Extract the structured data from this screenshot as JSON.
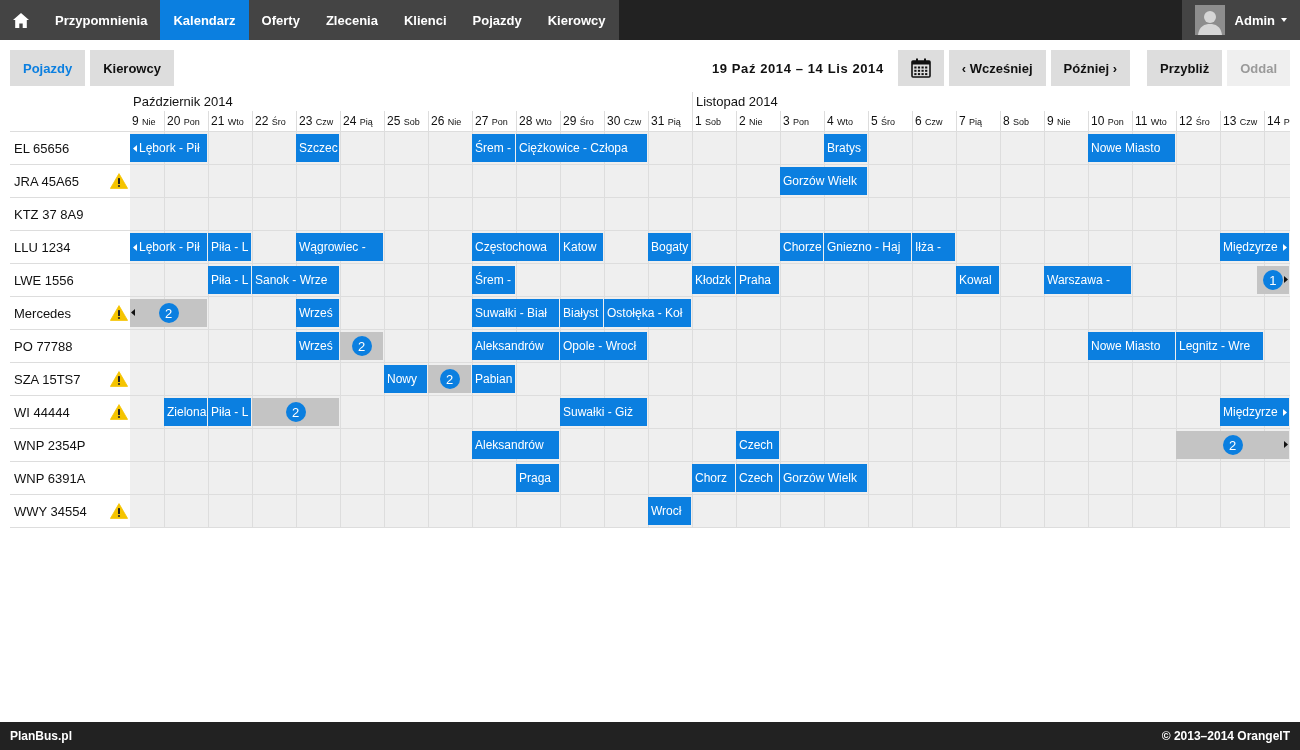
{
  "nav": {
    "items": [
      {
        "label": "Przypomnienia",
        "selected": false
      },
      {
        "label": "Kalendarz",
        "selected": true
      },
      {
        "label": "Oferty",
        "selected": false
      },
      {
        "label": "Zlecenia",
        "selected": false
      },
      {
        "label": "Klienci",
        "selected": false
      },
      {
        "label": "Pojazdy",
        "selected": false
      },
      {
        "label": "Kierowcy",
        "selected": false
      }
    ],
    "user": {
      "name": "Admin"
    }
  },
  "toolbar": {
    "views": [
      {
        "label": "Pojazdy",
        "selected": true
      },
      {
        "label": "Kierowcy",
        "selected": false
      }
    ],
    "range": "19 Paź 2014 – 14 Lis 2014",
    "navigation": [
      {
        "label": "‹ Wcześniej",
        "disabled": false
      },
      {
        "label": "Później ›",
        "disabled": false
      }
    ],
    "zoom": [
      {
        "label": "Przybliż",
        "disabled": false
      },
      {
        "label": "Oddal",
        "disabled": true
      }
    ]
  },
  "timeline": {
    "months": [
      {
        "label": "Październik 2014",
        "days": [
          {
            "day": "9",
            "weekday": "Nie"
          },
          {
            "day": "20",
            "weekday": "Pon"
          },
          {
            "day": "21",
            "weekday": "Wto"
          },
          {
            "day": "22",
            "weekday": "Śro"
          },
          {
            "day": "23",
            "weekday": "Czw"
          },
          {
            "day": "24",
            "weekday": "Pią"
          },
          {
            "day": "25",
            "weekday": "Sob"
          },
          {
            "day": "26",
            "weekday": "Nie"
          },
          {
            "day": "27",
            "weekday": "Pon"
          },
          {
            "day": "28",
            "weekday": "Wto"
          },
          {
            "day": "29",
            "weekday": "Śro"
          },
          {
            "day": "30",
            "weekday": "Czw"
          },
          {
            "day": "31",
            "weekday": "Pią"
          }
        ]
      },
      {
        "label": "Listopad 2014",
        "days": [
          {
            "day": "1",
            "weekday": "Sob"
          },
          {
            "day": "2",
            "weekday": "Nie"
          },
          {
            "day": "3",
            "weekday": "Pon"
          },
          {
            "day": "4",
            "weekday": "Wto"
          },
          {
            "day": "5",
            "weekday": "Śro"
          },
          {
            "day": "6",
            "weekday": "Czw"
          },
          {
            "day": "7",
            "weekday": "Pią"
          },
          {
            "day": "8",
            "weekday": "Sob"
          },
          {
            "day": "9",
            "weekday": "Nie"
          },
          {
            "day": "10",
            "weekday": "Pon"
          },
          {
            "day": "11",
            "weekday": "Wto"
          },
          {
            "day": "12",
            "weekday": "Śro"
          },
          {
            "day": "13",
            "weekday": "Czw"
          },
          {
            "day": "14",
            "weekday": "P"
          }
        ]
      }
    ],
    "rows": [
      {
        "name": "EL 65656",
        "warning": false,
        "slots": [
          {
            "kind": "trip",
            "label": "Lębork - Pił",
            "continues_before": true,
            "continues_after": false,
            "late_start": false
          },
          {
            "kind": "continued"
          },
          {
            "kind": "empty"
          },
          {
            "kind": "empty"
          },
          {
            "kind": "trip",
            "label": "Szczec",
            "continues_before": false,
            "continues_after": false,
            "late_start": false
          },
          {
            "kind": "empty"
          },
          {
            "kind": "empty"
          },
          {
            "kind": "empty"
          },
          {
            "kind": "trip",
            "label": "Śrem -",
            "continues_before": false,
            "continues_after": false,
            "late_start": false
          },
          {
            "kind": "trip",
            "label": "Ciężkowice - Człopa",
            "continues_before": false,
            "continues_after": false,
            "late_start": false
          },
          {
            "kind": "continued"
          },
          {
            "kind": "continued"
          },
          {
            "kind": "empty"
          },
          {
            "kind": "empty"
          },
          {
            "kind": "empty"
          },
          {
            "kind": "empty"
          },
          {
            "kind": "trip",
            "label": "Bratys",
            "continues_before": false,
            "continues_after": false,
            "late_start": false
          },
          {
            "kind": "empty"
          },
          {
            "kind": "empty"
          },
          {
            "kind": "empty"
          },
          {
            "kind": "empty"
          },
          {
            "kind": "empty"
          },
          {
            "kind": "trip",
            "label": "Nowe Miasto",
            "continues_before": false,
            "continues_after": false,
            "late_start": false
          },
          {
            "kind": "continued"
          },
          {
            "kind": "empty"
          },
          {
            "kind": "empty"
          },
          {
            "kind": "empty"
          }
        ]
      },
      {
        "name": "JRA 45A65",
        "warning": true,
        "slots": [
          {
            "kind": "empty"
          },
          {
            "kind": "empty"
          },
          {
            "kind": "empty"
          },
          {
            "kind": "empty"
          },
          {
            "kind": "empty"
          },
          {
            "kind": "empty"
          },
          {
            "kind": "empty"
          },
          {
            "kind": "empty"
          },
          {
            "kind": "empty"
          },
          {
            "kind": "empty"
          },
          {
            "kind": "empty"
          },
          {
            "kind": "empty"
          },
          {
            "kind": "empty"
          },
          {
            "kind": "empty"
          },
          {
            "kind": "empty"
          },
          {
            "kind": "trip",
            "label": "Gorzów Wielk",
            "continues_before": false,
            "continues_after": false,
            "late_start": false
          },
          {
            "kind": "continued"
          },
          {
            "kind": "empty"
          },
          {
            "kind": "empty"
          },
          {
            "kind": "empty"
          },
          {
            "kind": "empty"
          },
          {
            "kind": "empty"
          },
          {
            "kind": "empty"
          },
          {
            "kind": "empty"
          },
          {
            "kind": "empty"
          },
          {
            "kind": "empty"
          },
          {
            "kind": "empty"
          }
        ]
      },
      {
        "name": "KTZ 37 8A9",
        "warning": false,
        "slots": [
          {
            "kind": "empty"
          },
          {
            "kind": "empty"
          },
          {
            "kind": "empty"
          },
          {
            "kind": "empty"
          },
          {
            "kind": "empty"
          },
          {
            "kind": "empty"
          },
          {
            "kind": "empty"
          },
          {
            "kind": "empty"
          },
          {
            "kind": "empty"
          },
          {
            "kind": "empty"
          },
          {
            "kind": "empty"
          },
          {
            "kind": "empty"
          },
          {
            "kind": "empty"
          },
          {
            "kind": "empty"
          },
          {
            "kind": "empty"
          },
          {
            "kind": "empty"
          },
          {
            "kind": "empty"
          },
          {
            "kind": "empty"
          },
          {
            "kind": "empty"
          },
          {
            "kind": "empty"
          },
          {
            "kind": "empty"
          },
          {
            "kind": "empty"
          },
          {
            "kind": "empty"
          },
          {
            "kind": "empty"
          },
          {
            "kind": "empty"
          },
          {
            "kind": "empty"
          },
          {
            "kind": "empty"
          }
        ]
      },
      {
        "name": "LLU 1234",
        "warning": false,
        "slots": [
          {
            "kind": "trip",
            "label": "Lębork - Pił",
            "continues_before": true,
            "continues_after": false,
            "late_start": false
          },
          {
            "kind": "continued"
          },
          {
            "kind": "trip",
            "label": "Piła - L",
            "continues_before": false,
            "continues_after": false,
            "late_start": false
          },
          {
            "kind": "empty"
          },
          {
            "kind": "trip",
            "label": "Wągrowiec -",
            "continues_before": false,
            "continues_after": false,
            "late_start": false
          },
          {
            "kind": "continued"
          },
          {
            "kind": "empty"
          },
          {
            "kind": "empty"
          },
          {
            "kind": "trip",
            "label": "Częstochowa",
            "continues_before": false,
            "continues_after": false,
            "late_start": false
          },
          {
            "kind": "continued"
          },
          {
            "kind": "trip",
            "label": "Katow",
            "continues_before": false,
            "continues_after": false,
            "late_start": false
          },
          {
            "kind": "empty"
          },
          {
            "kind": "trip",
            "label": "Bogaty",
            "continues_before": false,
            "continues_after": false,
            "late_start": false
          },
          {
            "kind": "empty"
          },
          {
            "kind": "empty"
          },
          {
            "kind": "trip",
            "label": "Chorze",
            "continues_before": false,
            "continues_after": false,
            "late_start": false
          },
          {
            "kind": "trip",
            "label": "Gniezno - Haj",
            "continues_before": false,
            "continues_after": false,
            "late_start": false
          },
          {
            "kind": "continued"
          },
          {
            "kind": "trip",
            "label": "Iłża -",
            "continues_before": false,
            "continues_after": false,
            "late_start": false
          },
          {
            "kind": "empty"
          },
          {
            "kind": "empty"
          },
          {
            "kind": "empty"
          },
          {
            "kind": "empty"
          },
          {
            "kind": "empty"
          },
          {
            "kind": "empty"
          },
          {
            "kind": "trip",
            "label": "Międzyrze",
            "continues_before": false,
            "continues_after": true,
            "late_start": false
          },
          {
            "kind": "continued"
          }
        ]
      },
      {
        "name": "LWE 1556",
        "warning": false,
        "slots": [
          {
            "kind": "empty"
          },
          {
            "kind": "empty"
          },
          {
            "kind": "trip",
            "label": "Piła - L",
            "continues_before": false,
            "continues_after": false,
            "late_start": false
          },
          {
            "kind": "trip",
            "label": "Sanok - Wrze",
            "continues_before": false,
            "continues_after": false,
            "late_start": false
          },
          {
            "kind": "continued"
          },
          {
            "kind": "empty"
          },
          {
            "kind": "empty"
          },
          {
            "kind": "empty"
          },
          {
            "kind": "trip",
            "label": "Śrem -",
            "continues_before": false,
            "continues_after": false,
            "late_start": false
          },
          {
            "kind": "empty"
          },
          {
            "kind": "empty"
          },
          {
            "kind": "empty"
          },
          {
            "kind": "empty"
          },
          {
            "kind": "trip",
            "label": "Kłodzk",
            "continues_before": false,
            "continues_after": false,
            "late_start": false
          },
          {
            "kind": "trip",
            "label": "Praha",
            "continues_before": false,
            "continues_after": false,
            "late_start": false
          },
          {
            "kind": "empty"
          },
          {
            "kind": "empty"
          },
          {
            "kind": "empty"
          },
          {
            "kind": "empty"
          },
          {
            "kind": "trip",
            "label": "Kowal",
            "continues_before": false,
            "continues_after": false,
            "late_start": false
          },
          {
            "kind": "empty"
          },
          {
            "kind": "trip",
            "label": "Warszawa -",
            "continues_before": false,
            "continues_after": false,
            "late_start": false
          },
          {
            "kind": "continued"
          },
          {
            "kind": "empty"
          },
          {
            "kind": "empty"
          },
          {
            "kind": "group",
            "count": "1",
            "continues_before": false,
            "continues_after": true,
            "late_start": true
          },
          {
            "kind": "continued"
          }
        ]
      },
      {
        "name": "Mercedes",
        "warning": true,
        "slots": [
          {
            "kind": "group",
            "count": "2",
            "continues_before": true,
            "continues_after": false,
            "late_start": false
          },
          {
            "kind": "continued"
          },
          {
            "kind": "empty"
          },
          {
            "kind": "empty"
          },
          {
            "kind": "trip",
            "label": "Wrześ",
            "continues_before": false,
            "continues_after": false,
            "late_start": false
          },
          {
            "kind": "empty"
          },
          {
            "kind": "empty"
          },
          {
            "kind": "empty"
          },
          {
            "kind": "trip",
            "label": "Suwałki - Biał",
            "continues_before": false,
            "continues_after": false,
            "late_start": false
          },
          {
            "kind": "continued"
          },
          {
            "kind": "trip",
            "label": "Białyst",
            "continues_before": false,
            "continues_after": false,
            "late_start": false
          },
          {
            "kind": "trip",
            "label": "Ostołęka - Koł",
            "continues_before": false,
            "continues_after": false,
            "late_start": false
          },
          {
            "kind": "continued"
          },
          {
            "kind": "empty"
          },
          {
            "kind": "empty"
          },
          {
            "kind": "empty"
          },
          {
            "kind": "empty"
          },
          {
            "kind": "empty"
          },
          {
            "kind": "empty"
          },
          {
            "kind": "empty"
          },
          {
            "kind": "empty"
          },
          {
            "kind": "empty"
          },
          {
            "kind": "empty"
          },
          {
            "kind": "empty"
          },
          {
            "kind": "empty"
          },
          {
            "kind": "empty"
          },
          {
            "kind": "empty"
          }
        ]
      },
      {
        "name": "PO 77788",
        "warning": false,
        "slots": [
          {
            "kind": "empty"
          },
          {
            "kind": "empty"
          },
          {
            "kind": "empty"
          },
          {
            "kind": "empty"
          },
          {
            "kind": "trip",
            "label": "Wrześ",
            "continues_before": false,
            "continues_after": false,
            "late_start": false
          },
          {
            "kind": "group",
            "count": "2",
            "continues_before": false,
            "continues_after": false,
            "late_start": false
          },
          {
            "kind": "empty"
          },
          {
            "kind": "empty"
          },
          {
            "kind": "trip",
            "label": "Aleksandrów",
            "continues_before": false,
            "continues_after": false,
            "late_start": false
          },
          {
            "kind": "continued"
          },
          {
            "kind": "trip",
            "label": "Opole - Wrocł",
            "continues_before": false,
            "continues_after": false,
            "late_start": false
          },
          {
            "kind": "continued"
          },
          {
            "kind": "empty"
          },
          {
            "kind": "empty"
          },
          {
            "kind": "empty"
          },
          {
            "kind": "empty"
          },
          {
            "kind": "empty"
          },
          {
            "kind": "empty"
          },
          {
            "kind": "empty"
          },
          {
            "kind": "empty"
          },
          {
            "kind": "empty"
          },
          {
            "kind": "empty"
          },
          {
            "kind": "trip",
            "label": "Nowe Miasto",
            "continues_before": false,
            "continues_after": false,
            "late_start": false
          },
          {
            "kind": "continued"
          },
          {
            "kind": "trip",
            "label": "Legnitz - Wre",
            "continues_before": false,
            "continues_after": false,
            "late_start": false
          },
          {
            "kind": "continued"
          },
          {
            "kind": "empty"
          }
        ]
      },
      {
        "name": "SZA 15TS7",
        "warning": true,
        "slots": [
          {
            "kind": "empty"
          },
          {
            "kind": "empty"
          },
          {
            "kind": "empty"
          },
          {
            "kind": "empty"
          },
          {
            "kind": "empty"
          },
          {
            "kind": "empty"
          },
          {
            "kind": "trip",
            "label": "Nowy",
            "continues_before": false,
            "continues_after": false,
            "late_start": false
          },
          {
            "kind": "group",
            "count": "2",
            "continues_before": false,
            "continues_after": false,
            "late_start": false
          },
          {
            "kind": "trip",
            "label": "Pabian",
            "continues_before": false,
            "continues_after": false,
            "late_start": false
          },
          {
            "kind": "empty"
          },
          {
            "kind": "empty"
          },
          {
            "kind": "empty"
          },
          {
            "kind": "empty"
          },
          {
            "kind": "empty"
          },
          {
            "kind": "empty"
          },
          {
            "kind": "empty"
          },
          {
            "kind": "empty"
          },
          {
            "kind": "empty"
          },
          {
            "kind": "empty"
          },
          {
            "kind": "empty"
          },
          {
            "kind": "empty"
          },
          {
            "kind": "empty"
          },
          {
            "kind": "empty"
          },
          {
            "kind": "empty"
          },
          {
            "kind": "empty"
          },
          {
            "kind": "empty"
          },
          {
            "kind": "empty"
          }
        ]
      },
      {
        "name": "WI 44444",
        "warning": true,
        "slots": [
          {
            "kind": "empty"
          },
          {
            "kind": "trip",
            "label": "Zielona",
            "continues_before": false,
            "continues_after": false,
            "late_start": false
          },
          {
            "kind": "trip",
            "label": "Piła - L",
            "continues_before": false,
            "continues_after": false,
            "late_start": false
          },
          {
            "kind": "group",
            "count": "2",
            "continues_before": false,
            "continues_after": false,
            "late_start": false
          },
          {
            "kind": "continued"
          },
          {
            "kind": "empty"
          },
          {
            "kind": "empty"
          },
          {
            "kind": "empty"
          },
          {
            "kind": "empty"
          },
          {
            "kind": "empty"
          },
          {
            "kind": "trip",
            "label": "Suwałki - Giż",
            "continues_before": false,
            "continues_after": false,
            "late_start": false
          },
          {
            "kind": "continued"
          },
          {
            "kind": "empty"
          },
          {
            "kind": "empty"
          },
          {
            "kind": "empty"
          },
          {
            "kind": "empty"
          },
          {
            "kind": "empty"
          },
          {
            "kind": "empty"
          },
          {
            "kind": "empty"
          },
          {
            "kind": "empty"
          },
          {
            "kind": "empty"
          },
          {
            "kind": "empty"
          },
          {
            "kind": "empty"
          },
          {
            "kind": "empty"
          },
          {
            "kind": "empty"
          },
          {
            "kind": "trip",
            "label": "Międzyrze",
            "continues_before": false,
            "continues_after": true,
            "late_start": false
          },
          {
            "kind": "continued"
          }
        ]
      },
      {
        "name": "WNP 2354P",
        "warning": false,
        "slots": [
          {
            "kind": "empty"
          },
          {
            "kind": "empty"
          },
          {
            "kind": "empty"
          },
          {
            "kind": "empty"
          },
          {
            "kind": "empty"
          },
          {
            "kind": "empty"
          },
          {
            "kind": "empty"
          },
          {
            "kind": "empty"
          },
          {
            "kind": "trip",
            "label": "Aleksandrów",
            "continues_before": false,
            "continues_after": false,
            "late_start": false
          },
          {
            "kind": "continued"
          },
          {
            "kind": "empty"
          },
          {
            "kind": "empty"
          },
          {
            "kind": "empty"
          },
          {
            "kind": "empty"
          },
          {
            "kind": "trip",
            "label": "Czech",
            "continues_before": false,
            "continues_after": false,
            "late_start": false
          },
          {
            "kind": "empty"
          },
          {
            "kind": "empty"
          },
          {
            "kind": "empty"
          },
          {
            "kind": "empty"
          },
          {
            "kind": "empty"
          },
          {
            "kind": "empty"
          },
          {
            "kind": "empty"
          },
          {
            "kind": "empty"
          },
          {
            "kind": "empty"
          },
          {
            "kind": "group",
            "count": "2",
            "continues_before": false,
            "continues_after": true,
            "late_start": false
          },
          {
            "kind": "continued"
          },
          {
            "kind": "continued"
          }
        ]
      },
      {
        "name": "WNP 6391A",
        "warning": false,
        "slots": [
          {
            "kind": "empty"
          },
          {
            "kind": "empty"
          },
          {
            "kind": "empty"
          },
          {
            "kind": "empty"
          },
          {
            "kind": "empty"
          },
          {
            "kind": "empty"
          },
          {
            "kind": "empty"
          },
          {
            "kind": "empty"
          },
          {
            "kind": "empty"
          },
          {
            "kind": "trip",
            "label": "Praga",
            "continues_before": false,
            "continues_after": false,
            "late_start": false
          },
          {
            "kind": "empty"
          },
          {
            "kind": "empty"
          },
          {
            "kind": "empty"
          },
          {
            "kind": "trip",
            "label": "Chorz",
            "continues_before": false,
            "continues_after": false,
            "late_start": false
          },
          {
            "kind": "trip",
            "label": "Czech",
            "continues_before": false,
            "continues_after": false,
            "late_start": false
          },
          {
            "kind": "trip",
            "label": "Gorzów Wielk",
            "continues_before": false,
            "continues_after": false,
            "late_start": false
          },
          {
            "kind": "continued"
          },
          {
            "kind": "empty"
          },
          {
            "kind": "empty"
          },
          {
            "kind": "empty"
          },
          {
            "kind": "empty"
          },
          {
            "kind": "empty"
          },
          {
            "kind": "empty"
          },
          {
            "kind": "empty"
          },
          {
            "kind": "empty"
          },
          {
            "kind": "empty"
          },
          {
            "kind": "empty"
          }
        ]
      },
      {
        "name": "WWY 34554",
        "warning": true,
        "slots": [
          {
            "kind": "empty"
          },
          {
            "kind": "empty"
          },
          {
            "kind": "empty"
          },
          {
            "kind": "empty"
          },
          {
            "kind": "empty"
          },
          {
            "kind": "empty"
          },
          {
            "kind": "empty"
          },
          {
            "kind": "empty"
          },
          {
            "kind": "empty"
          },
          {
            "kind": "empty"
          },
          {
            "kind": "empty"
          },
          {
            "kind": "empty"
          },
          {
            "kind": "trip",
            "label": "Wrocł",
            "continues_before": false,
            "continues_after": false,
            "late_start": false
          },
          {
            "kind": "empty"
          },
          {
            "kind": "empty"
          },
          {
            "kind": "empty"
          },
          {
            "kind": "empty"
          },
          {
            "kind": "empty"
          },
          {
            "kind": "empty"
          },
          {
            "kind": "empty"
          },
          {
            "kind": "empty"
          },
          {
            "kind": "empty"
          },
          {
            "kind": "empty"
          },
          {
            "kind": "empty"
          },
          {
            "kind": "empty"
          },
          {
            "kind": "empty"
          },
          {
            "kind": "empty"
          }
        ]
      }
    ]
  },
  "footer": {
    "brand": "PlanBus.pl",
    "copyright": "© 2013–2014 OrangeIT"
  }
}
